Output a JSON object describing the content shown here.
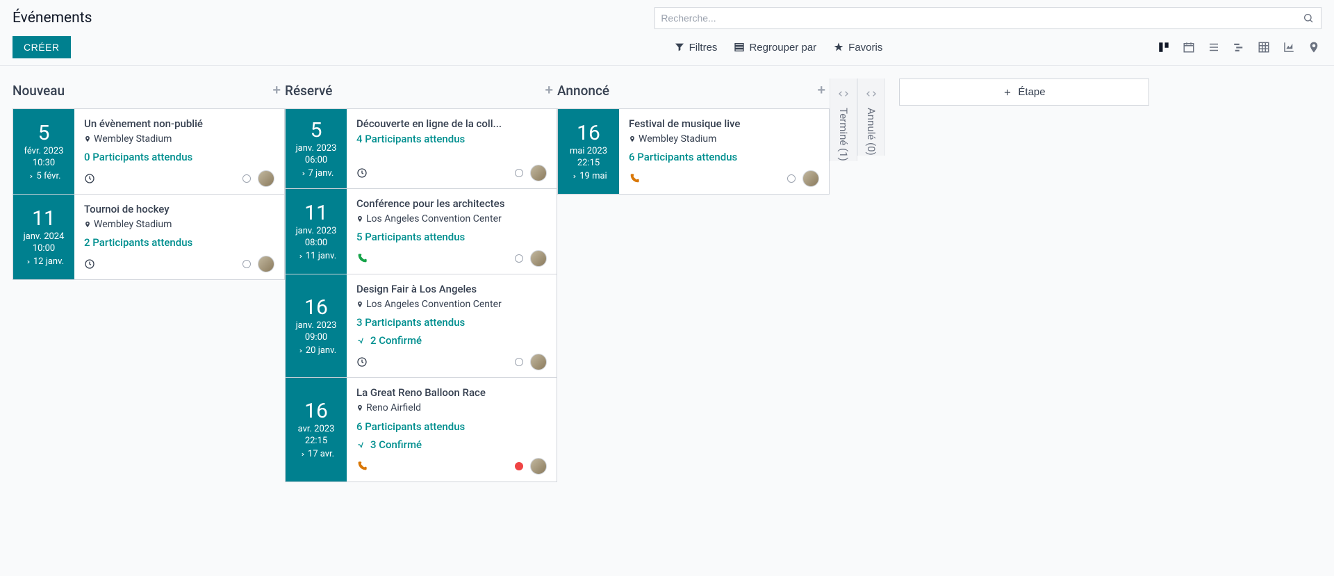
{
  "page_title": "Événements",
  "search_placeholder": "Recherche...",
  "create_label": "CRÉER",
  "filters_label": "Filtres",
  "groupby_label": "Regrouper par",
  "favorites_label": "Favoris",
  "add_stage_label": "Étape",
  "columns": [
    {
      "title": "Nouveau",
      "cards": [
        {
          "day": "5",
          "month": "févr. 2023",
          "time": "10:30",
          "end": "5 févr.",
          "title": "Un évènement non-publié",
          "location": "Wembley Stadium",
          "attendees": "0 Participants attendus",
          "confirmed": "",
          "foot_icon": "clock",
          "status": "grey"
        },
        {
          "day": "11",
          "month": "janv. 2024",
          "time": "10:00",
          "end": "12 janv.",
          "title": "Tournoi de hockey",
          "location": "Wembley Stadium",
          "attendees": "2 Participants attendus",
          "confirmed": "",
          "foot_icon": "clock",
          "status": "grey"
        }
      ]
    },
    {
      "title": "Réservé",
      "cards": [
        {
          "day": "5",
          "month": "janv. 2023",
          "time": "06:00",
          "end": "7 janv.",
          "title": "Découverte en ligne de la coll...",
          "location": "",
          "attendees": "4 Participants attendus",
          "confirmed": "",
          "foot_icon": "clock",
          "status": "grey"
        },
        {
          "day": "11",
          "month": "janv. 2023",
          "time": "08:00",
          "end": "11 janv.",
          "title": "Conférence pour les architectes",
          "location": "Los Angeles Convention Center",
          "attendees": "5 Participants attendus",
          "confirmed": "",
          "foot_icon": "phone-green",
          "status": "grey"
        },
        {
          "day": "16",
          "month": "janv. 2023",
          "time": "09:00",
          "end": "20 janv.",
          "title": "Design Fair à Los Angeles",
          "location": "Los Angeles Convention Center",
          "attendees": "3 Participants attendus",
          "confirmed": "2 Confirmé",
          "foot_icon": "clock",
          "status": "grey"
        },
        {
          "day": "16",
          "month": "avr. 2023",
          "time": "22:15",
          "end": "17 avr.",
          "title": "La Great Reno Balloon Race",
          "location": "Reno Airfield",
          "attendees": "6 Participants attendus",
          "confirmed": "3 Confirmé",
          "foot_icon": "phone-orange",
          "status": "red"
        }
      ]
    },
    {
      "title": "Annoncé",
      "cards": [
        {
          "day": "16",
          "month": "mai 2023",
          "time": "22:15",
          "end": "19 mai",
          "title": "Festival de musique live",
          "location": "Wembley Stadium",
          "attendees": "6 Participants attendus",
          "confirmed": "",
          "foot_icon": "phone-orange",
          "status": "grey"
        }
      ]
    }
  ],
  "folded_columns": [
    {
      "label": "Terminé (1)"
    },
    {
      "label": "Annulé (0)"
    }
  ]
}
